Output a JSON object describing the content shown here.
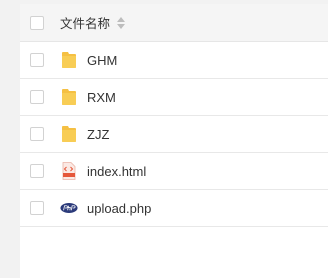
{
  "table": {
    "header": {
      "name_label": "文件名称"
    },
    "rows": [
      {
        "name": "GHM",
        "icon": "folder-icon"
      },
      {
        "name": "RXM",
        "icon": "folder-icon"
      },
      {
        "name": "ZJZ",
        "icon": "folder-icon"
      },
      {
        "name": "index.html",
        "icon": "html-file-icon"
      },
      {
        "name": "upload.php",
        "icon": "php-file-icon"
      }
    ]
  },
  "colors": {
    "folder": "#f5c043",
    "php_badge": "#2b3a7a",
    "html_badge": "#e5573a"
  }
}
